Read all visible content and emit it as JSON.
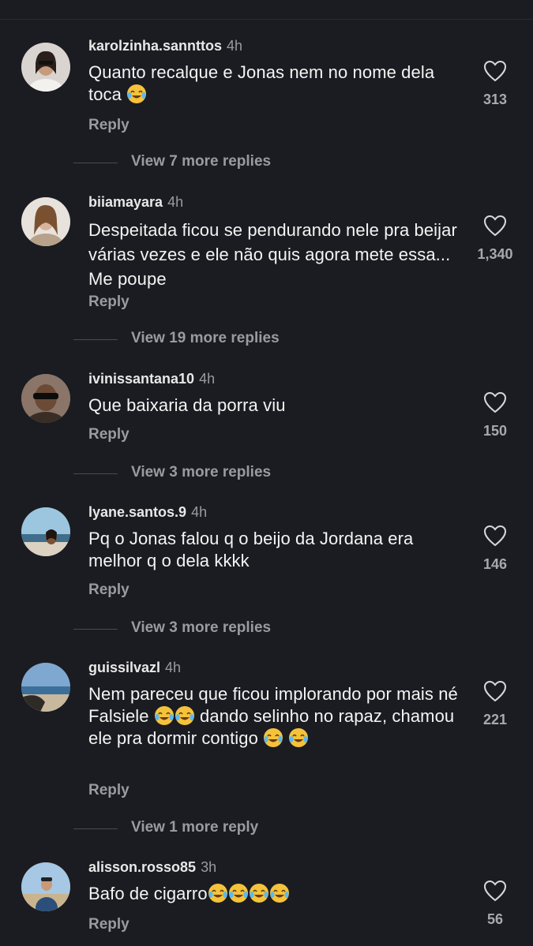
{
  "reply_label": "Reply",
  "comments": [
    {
      "username": "karolzinha.sannttos",
      "time": "4h",
      "text": "Quanto recalque e Jonas nem no nome dela toca",
      "emojis": 1,
      "likes": "313",
      "more_replies": "View 7 more replies"
    },
    {
      "username": "biiamayara",
      "time": "4h",
      "text": "Despeitada ficou se pendurando nele pra beijar várias vezes e ele não quis agora mete essa... Me poupe",
      "emojis": 0,
      "likes": "1,340",
      "more_replies": "View 19 more replies"
    },
    {
      "username": "ivinissantana10",
      "time": "4h",
      "text": "Que baixaria da porra viu",
      "emojis": 0,
      "likes": "150",
      "more_replies": "View 3 more replies"
    },
    {
      "username": "lyane.santos.9",
      "time": "4h",
      "text": "Pq o Jonas falou q o beijo da Jordana era melhor q o dela kkkk",
      "emojis": 0,
      "likes": "146",
      "more_replies": "View 3 more replies"
    },
    {
      "username": "guissilvazl",
      "time": "4h",
      "text_parts": [
        "Nem pareceu que ficou implorando por mais né Falsiele ",
        " dando selinho no rapaz, chamou ele pra dormir contigo "
      ],
      "likes": "221",
      "more_replies": "View 1 more reply"
    },
    {
      "username": "alisson.rosso85",
      "time": "3h",
      "text": "Bafo de cigarro",
      "emojis": 4,
      "likes": "56"
    }
  ],
  "icons": {
    "like": "heart-outline-icon",
    "emoji": "laughing-tears-emoji"
  }
}
